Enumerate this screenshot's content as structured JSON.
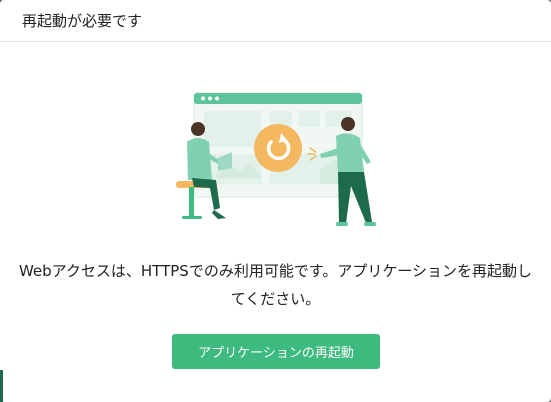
{
  "dialog": {
    "title": "再起動が必要です",
    "message": "Webアクセスは、HTTPSでのみ利用可能です。アプリケーションを再起動してください。",
    "restart_button_label": "アプリケーションの再起動"
  },
  "illustration": {
    "icon": "restart-icon",
    "colors": {
      "accent_green": "#3dbb7e",
      "mint": "#5cc39a",
      "dark_green": "#1d6b4a",
      "orange": "#f4b860"
    }
  }
}
